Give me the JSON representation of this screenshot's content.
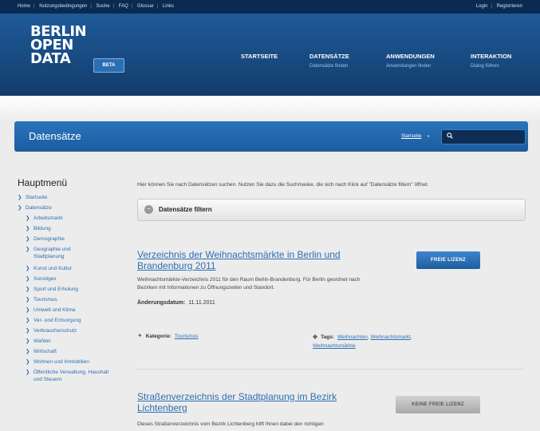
{
  "topbar": {
    "left_links": [
      "Home",
      "Nutzungsbedingungen",
      "Suche",
      "FAQ",
      "Glossar",
      "Links"
    ],
    "login": "Login",
    "register": "Registrieren"
  },
  "header": {
    "logo_lines": [
      "BERLIN",
      "OPEN",
      "DATA"
    ],
    "beta": "BETA",
    "nav": [
      {
        "label": "STARTSEITE",
        "sub": ""
      },
      {
        "label": "DATENSÄTZE",
        "sub": "Datensätze finden"
      },
      {
        "label": "ANWENDUNGEN",
        "sub": "Anwendungen finden"
      },
      {
        "label": "INTERAKTION",
        "sub": "Dialog führen"
      }
    ]
  },
  "titlebar": {
    "title": "Datensätze",
    "crumb": "Startseite",
    "crumb_arrow": "▸",
    "search_placeholder": ""
  },
  "sidebar": {
    "heading": "Hauptmenü",
    "items": [
      {
        "label": "Startseite",
        "level": 0
      },
      {
        "label": "Datensätze",
        "level": 0
      },
      {
        "label": "Arbeitsmarkt",
        "level": 1
      },
      {
        "label": "Bildung",
        "level": 1
      },
      {
        "label": "Demographie",
        "level": 1
      },
      {
        "label": "Geographie und Stadtplanung",
        "level": 1
      },
      {
        "label": "Kunst und Kultur",
        "level": 1
      },
      {
        "label": "Sonstiges",
        "level": 1
      },
      {
        "label": "Sport und Erholung",
        "level": 1
      },
      {
        "label": "Tourismus",
        "level": 1
      },
      {
        "label": "Umwelt und Klima",
        "level": 1
      },
      {
        "label": "Ver- und Entsorgung",
        "level": 1
      },
      {
        "label": "Verbraucherschutz",
        "level": 1
      },
      {
        "label": "Wahlen",
        "level": 1
      },
      {
        "label": "Wirtschaft",
        "level": 1
      },
      {
        "label": "Wohnen und Immobilien",
        "level": 1
      },
      {
        "label": "Öffentliche Verwaltung, Haushalt und Steuern",
        "level": 1
      }
    ]
  },
  "main": {
    "intro": "Hier können Sie nach Datensätzen suchen. Nutzen Sie dazu die Suchmaske, die sich nach Klick auf \"Datensätze filtern\" öffnet.",
    "filter_label": "Datensätze filtern",
    "datasets": [
      {
        "title_line1": "Verzeichnis der Weihnachtsmärkte in Berlin und",
        "title_line2": "Brandenburg 2011",
        "license": "FREIE LIZENZ",
        "desc_line1": "Weihnachtsmärkte-Verzeichnis 2011 für den Raum Berlin-Brandenburg. Für Berlin geordnet nach",
        "desc_line2": "Bezirken mit Informationen zu Öffnungszeiten und Standort.",
        "date_label": "Änderungsdatum:",
        "date": "11.11.2011",
        "category_label": "Kategorie:",
        "category": "Tourismus",
        "tags_label": "Tags:",
        "tags": [
          "Weihnachten",
          "Weihnachtsmarkt",
          "Weihnachtsmärkte"
        ]
      },
      {
        "title_line1": "Straßenverzeichnis der Stadtplanung im Bezirk",
        "title_line2": "Lichtenberg",
        "license": "KEINE FREIE LIZENZ",
        "desc_line1": "Dieses Straßenverzeichnis vom Bezirk Lichtenberg hilft Ihnen dabei den richtigen"
      }
    ]
  },
  "colors": {
    "topbar": "#0b2a52",
    "header": "#1f5a99",
    "link": "#2e6fb5",
    "free_license": "#2a6fb5",
    "nonfree_license": "#b5b5b5"
  }
}
